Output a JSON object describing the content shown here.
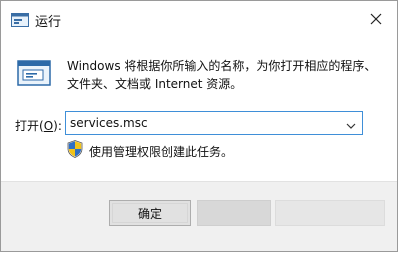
{
  "window": {
    "title": "运行"
  },
  "dialog": {
    "description": "Windows 将根据你所输入的名称，为你打开相应的程序、文件夹、文档或 Internet 资源。",
    "open_label": "打开(",
    "open_label_key": "O",
    "open_label_end": "):",
    "input_value": "services.msc",
    "admin_note": "使用管理权限创建此任务。"
  },
  "buttons": {
    "ok_label": "确定"
  },
  "colors": {
    "accent": "#3f8fd8",
    "footer_bg": "#f0f0f0"
  },
  "icons": {
    "title": "run-icon",
    "close": "close-icon",
    "main": "run-dialog-icon",
    "shield": "uac-shield-icon",
    "dropdown": "chevron-down-icon"
  }
}
